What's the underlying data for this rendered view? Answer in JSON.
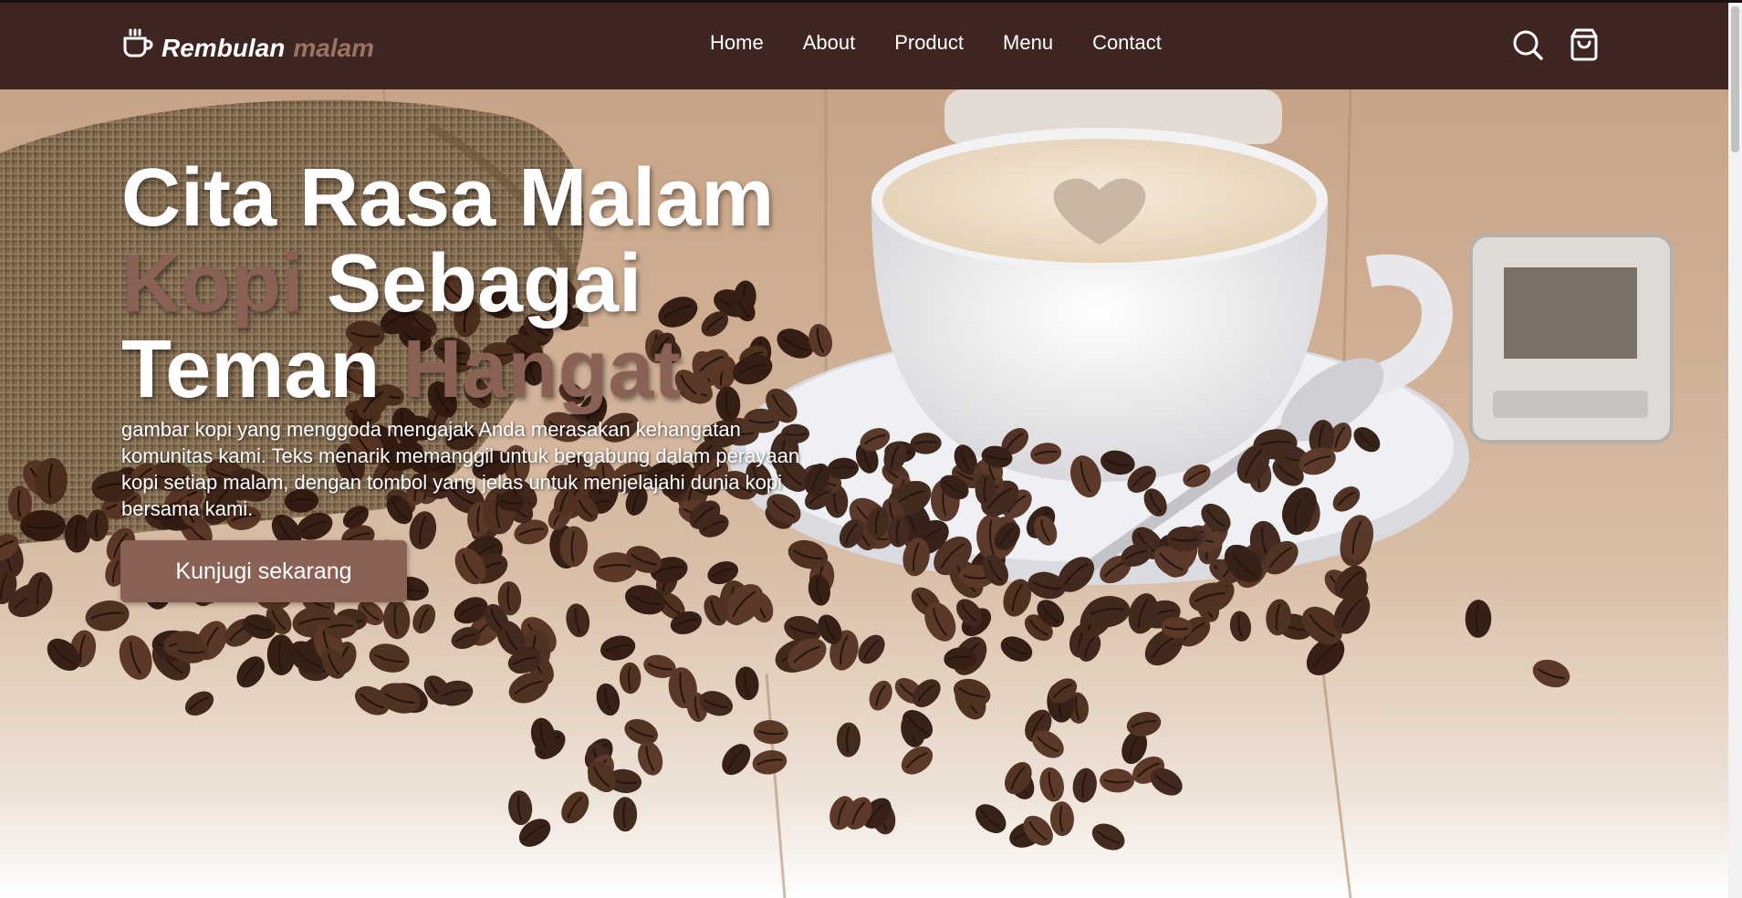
{
  "brand": {
    "name": "Rembulan",
    "accent": "malam",
    "icon": "coffee-cup-icon"
  },
  "nav": {
    "links": [
      "Home",
      "About",
      "Product",
      "Menu",
      "Contact"
    ],
    "icons": [
      "search-icon",
      "shopping-bag-icon"
    ]
  },
  "hero": {
    "title_line1": "Cita Rasa Malam",
    "title_kopi": "Kopi",
    "title_sebagai": "Sebagai",
    "title_teman": "Teman",
    "title_hangat": "Hangat",
    "description": "gambar kopi yang menggoda mengajak Anda merasakan kehangatan komunitas kami. Teks menarik memanggil untuk bergabung dalam perayaan kopi setiap malam, dengan tombol yang jelas untuk menjelajahi dunia kopi bersama kami.",
    "cta": "Kunjugi sekarang"
  },
  "colors": {
    "navbar": "#3e2521",
    "accent": "#8a6155",
    "text": "#ffffff"
  }
}
